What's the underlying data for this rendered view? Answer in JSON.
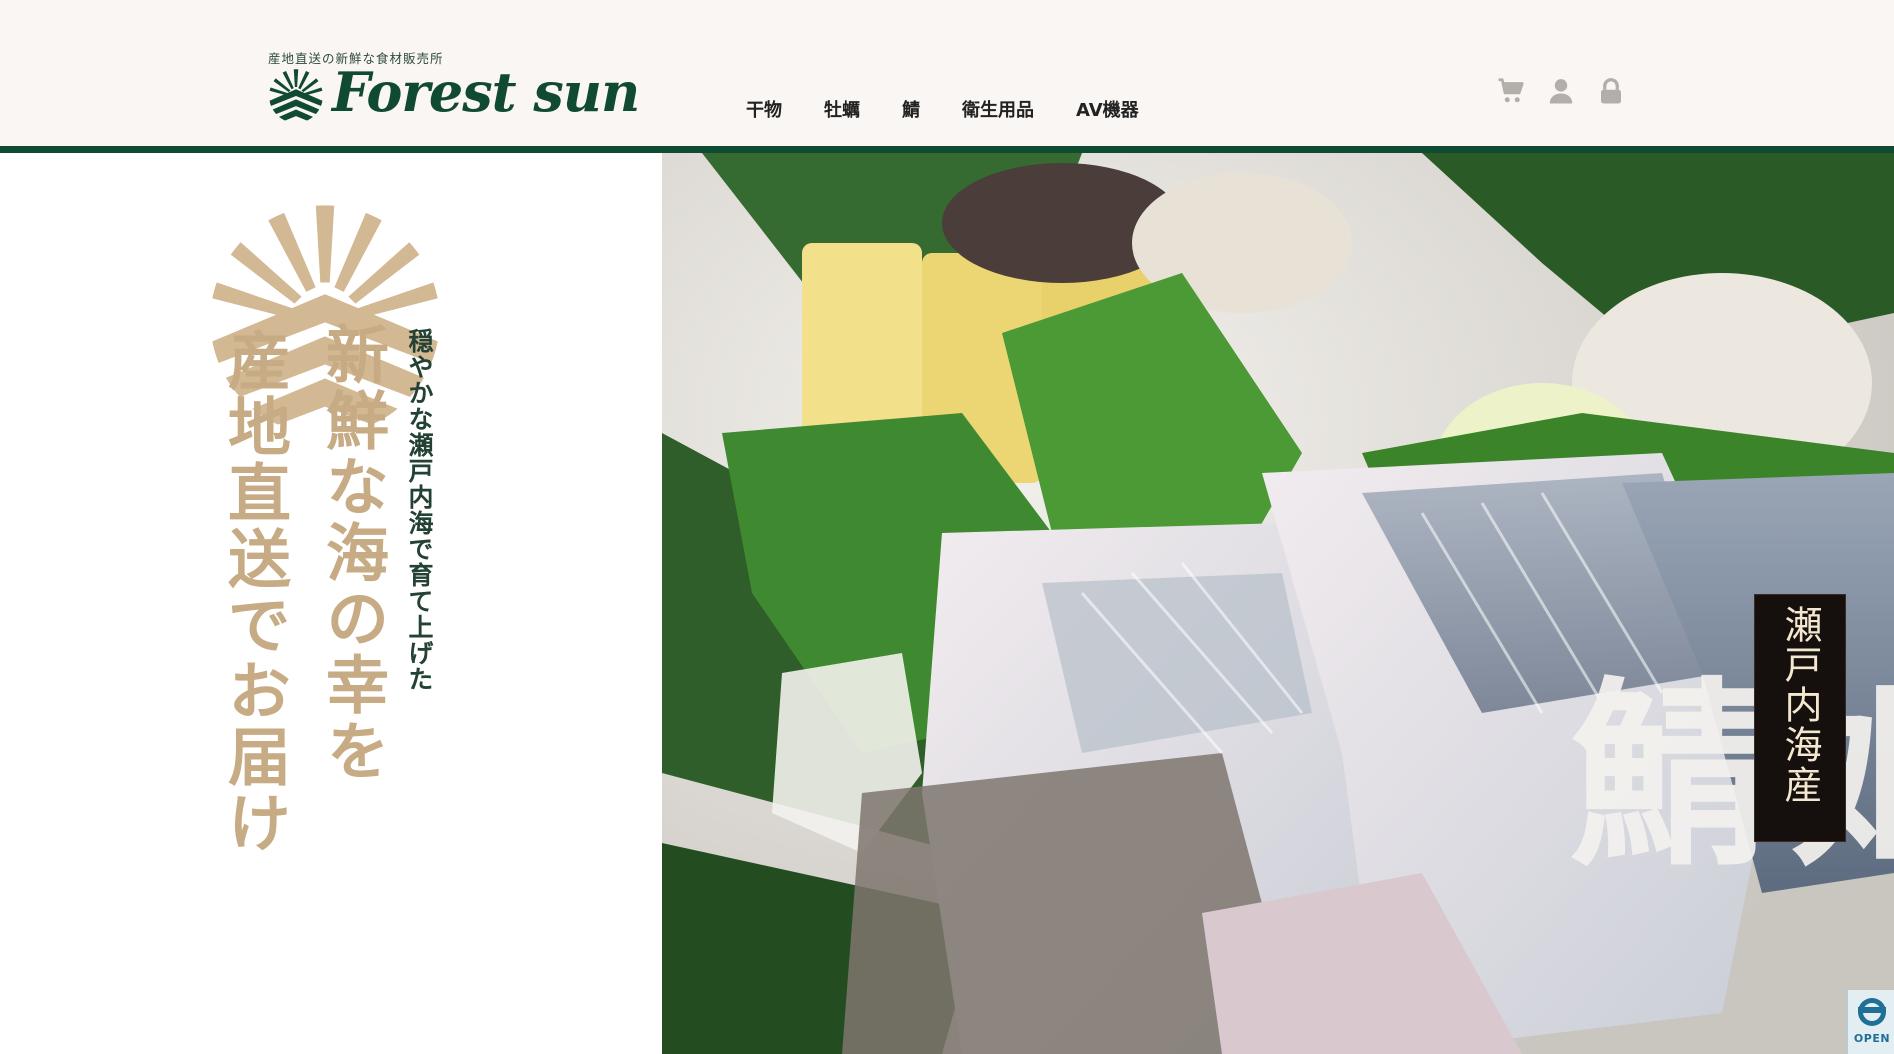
{
  "header": {
    "tagline": "産地直送の新鮮な食材販売所",
    "logo_text": "Forest sun",
    "nav": [
      {
        "label": "干物"
      },
      {
        "label": "牡蠣"
      },
      {
        "label": "鯖"
      },
      {
        "label": "衛生用品"
      },
      {
        "label": "AV機器"
      }
    ],
    "icons": [
      "cart-icon",
      "user-icon",
      "lock-icon"
    ]
  },
  "hero": {
    "sub_copy": "穏やかな瀬戸内海で育て上げた",
    "main_copy_1": "新鮮な海の幸を",
    "main_copy_2": "産地直送でお届け",
    "photo_label": "瀬戸内海産",
    "photo_brush_text": "姫鯖"
  },
  "badge": {
    "text": "OPEN"
  },
  "colors": {
    "brand_green": "#114a32",
    "accent_gold": "#c7ab85",
    "header_bg": "#f9f6f3"
  }
}
